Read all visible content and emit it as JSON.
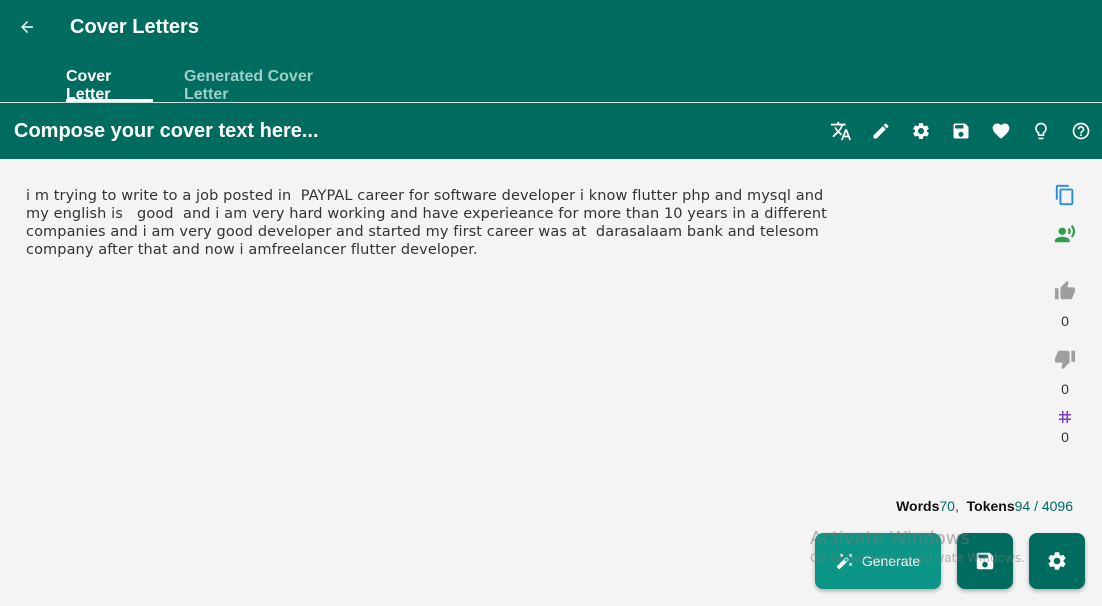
{
  "app": {
    "title": "Cover Letters",
    "back_icon": "arrow-back-icon"
  },
  "tabs": [
    {
      "label": "Cover Letter",
      "active": true
    },
    {
      "label": "Generated Cover Letter",
      "active": false
    }
  ],
  "toolbar": {
    "title": "Compose your cover text here...",
    "icons": [
      "translate-icon",
      "pencil-icon",
      "gear-icon",
      "save-icon",
      "heart-icon",
      "lightbulb-icon",
      "help-icon"
    ]
  },
  "editor": {
    "text": "i m trying to write to a job posted in  PAYPAL career for software developer i know flutter php and mysql and\nmy english is   good  and i am very hard working and have experieance for more than 10 years in a different\ncompanies and i am very good developer and started my first career was at  darasalaam bank and telesom\ncompany after that and now i amfreelancer flutter developer."
  },
  "side_actions": {
    "like_count": "0",
    "dislike_count": "0",
    "hash_count": "0"
  },
  "stats": {
    "words_label": "Words",
    "words_value": "70",
    "tokens_label": "Tokens",
    "tokens_value": "94 / 4096"
  },
  "fabs": {
    "generate_label": "Generate"
  },
  "watermark": {
    "title": "Activate Windows",
    "subtitle": "Go to Settings to activate Windows."
  },
  "colors": {
    "primary": "#006b5f",
    "accent": "#0b9587",
    "background": "#f4f4f4",
    "inactive_tab": "#9ccfc7"
  }
}
